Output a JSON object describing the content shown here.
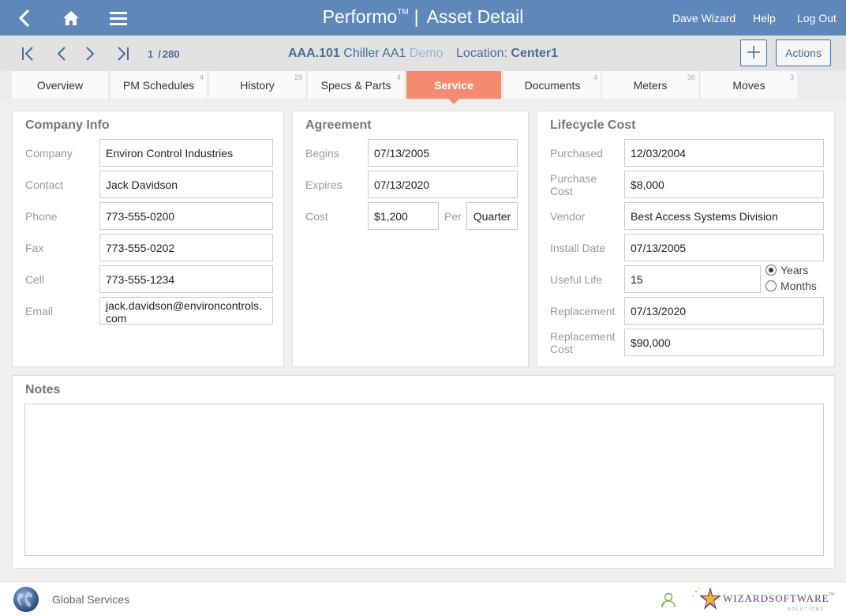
{
  "header": {
    "app_name": "Performo",
    "trademark": "TM",
    "separator": "|",
    "page_title": "Asset Detail",
    "user": "Dave Wizard",
    "help": "Help",
    "logout": "Log Out",
    "icons": [
      "back-arrow-icon",
      "home-icon",
      "menu-icon"
    ]
  },
  "record_nav": {
    "current": "1",
    "total": "280",
    "asset_code": "AAA.101",
    "asset_name": "Chiller AA1",
    "asset_tag": "Demo",
    "location_label": "Location:",
    "location_value": "Center1",
    "add_icon": "+",
    "actions_label": "Actions"
  },
  "tabs": [
    {
      "label": "Overview",
      "badge": ""
    },
    {
      "label": "PM Schedules",
      "badge": "4"
    },
    {
      "label": "History",
      "badge": "29"
    },
    {
      "label": "Specs & Parts",
      "badge": "4"
    },
    {
      "label": "Service",
      "badge": "",
      "active": true
    },
    {
      "label": "Documents",
      "badge": "4"
    },
    {
      "label": "Meters",
      "badge": "36"
    },
    {
      "label": "Moves",
      "badge": "3"
    }
  ],
  "company_info": {
    "title": "Company Info",
    "company_label": "Company",
    "company": "Environ Control Industries",
    "contact_label": "Contact",
    "contact": "Jack Davidson",
    "phone_label": "Phone",
    "phone": "773-555-0200",
    "fax_label": "Fax",
    "fax": "773-555-0202",
    "cell_label": "Cell",
    "cell": "773-555-1234",
    "email_label": "Email",
    "email": "jack.davidson@environcontrols.com"
  },
  "agreement": {
    "title": "Agreement",
    "begins_label": "Begins",
    "begins": "07/13/2005",
    "expires_label": "Expires",
    "expires": "07/13/2020",
    "cost_label": "Cost",
    "cost": "$1,200",
    "per_label": "Per",
    "per": "Quarter"
  },
  "lifecycle": {
    "title": "Lifecycle Cost",
    "purchased_label": "Purchased",
    "purchased": "12/03/2004",
    "purchase_cost_label_1": "Purchase",
    "purchase_cost_label_2": "Cost",
    "purchase_cost": "$8,000",
    "vendor_label": "Vendor",
    "vendor": "Best Access Systems Division",
    "install_label": "Install Date",
    "install": "07/13/2005",
    "useful_life_label": "Useful Life",
    "useful_life": "15",
    "unit_years": "Years",
    "unit_months": "Months",
    "unit_selected": "Years",
    "replacement_label": "Replacement",
    "replacement": "07/13/2020",
    "replacement_cost_label_1": "Replacement",
    "replacement_cost_label_2": "Cost",
    "replacement_cost": "$90,000"
  },
  "notes": {
    "title": "Notes",
    "value": ""
  },
  "footer": {
    "org": "Global Services",
    "brand": "WIZARDSOFTWARE",
    "brand_sub": "SOLUTIONS",
    "brand_tm": "TM",
    "icons": [
      "globe-icon",
      "user-icon"
    ]
  }
}
